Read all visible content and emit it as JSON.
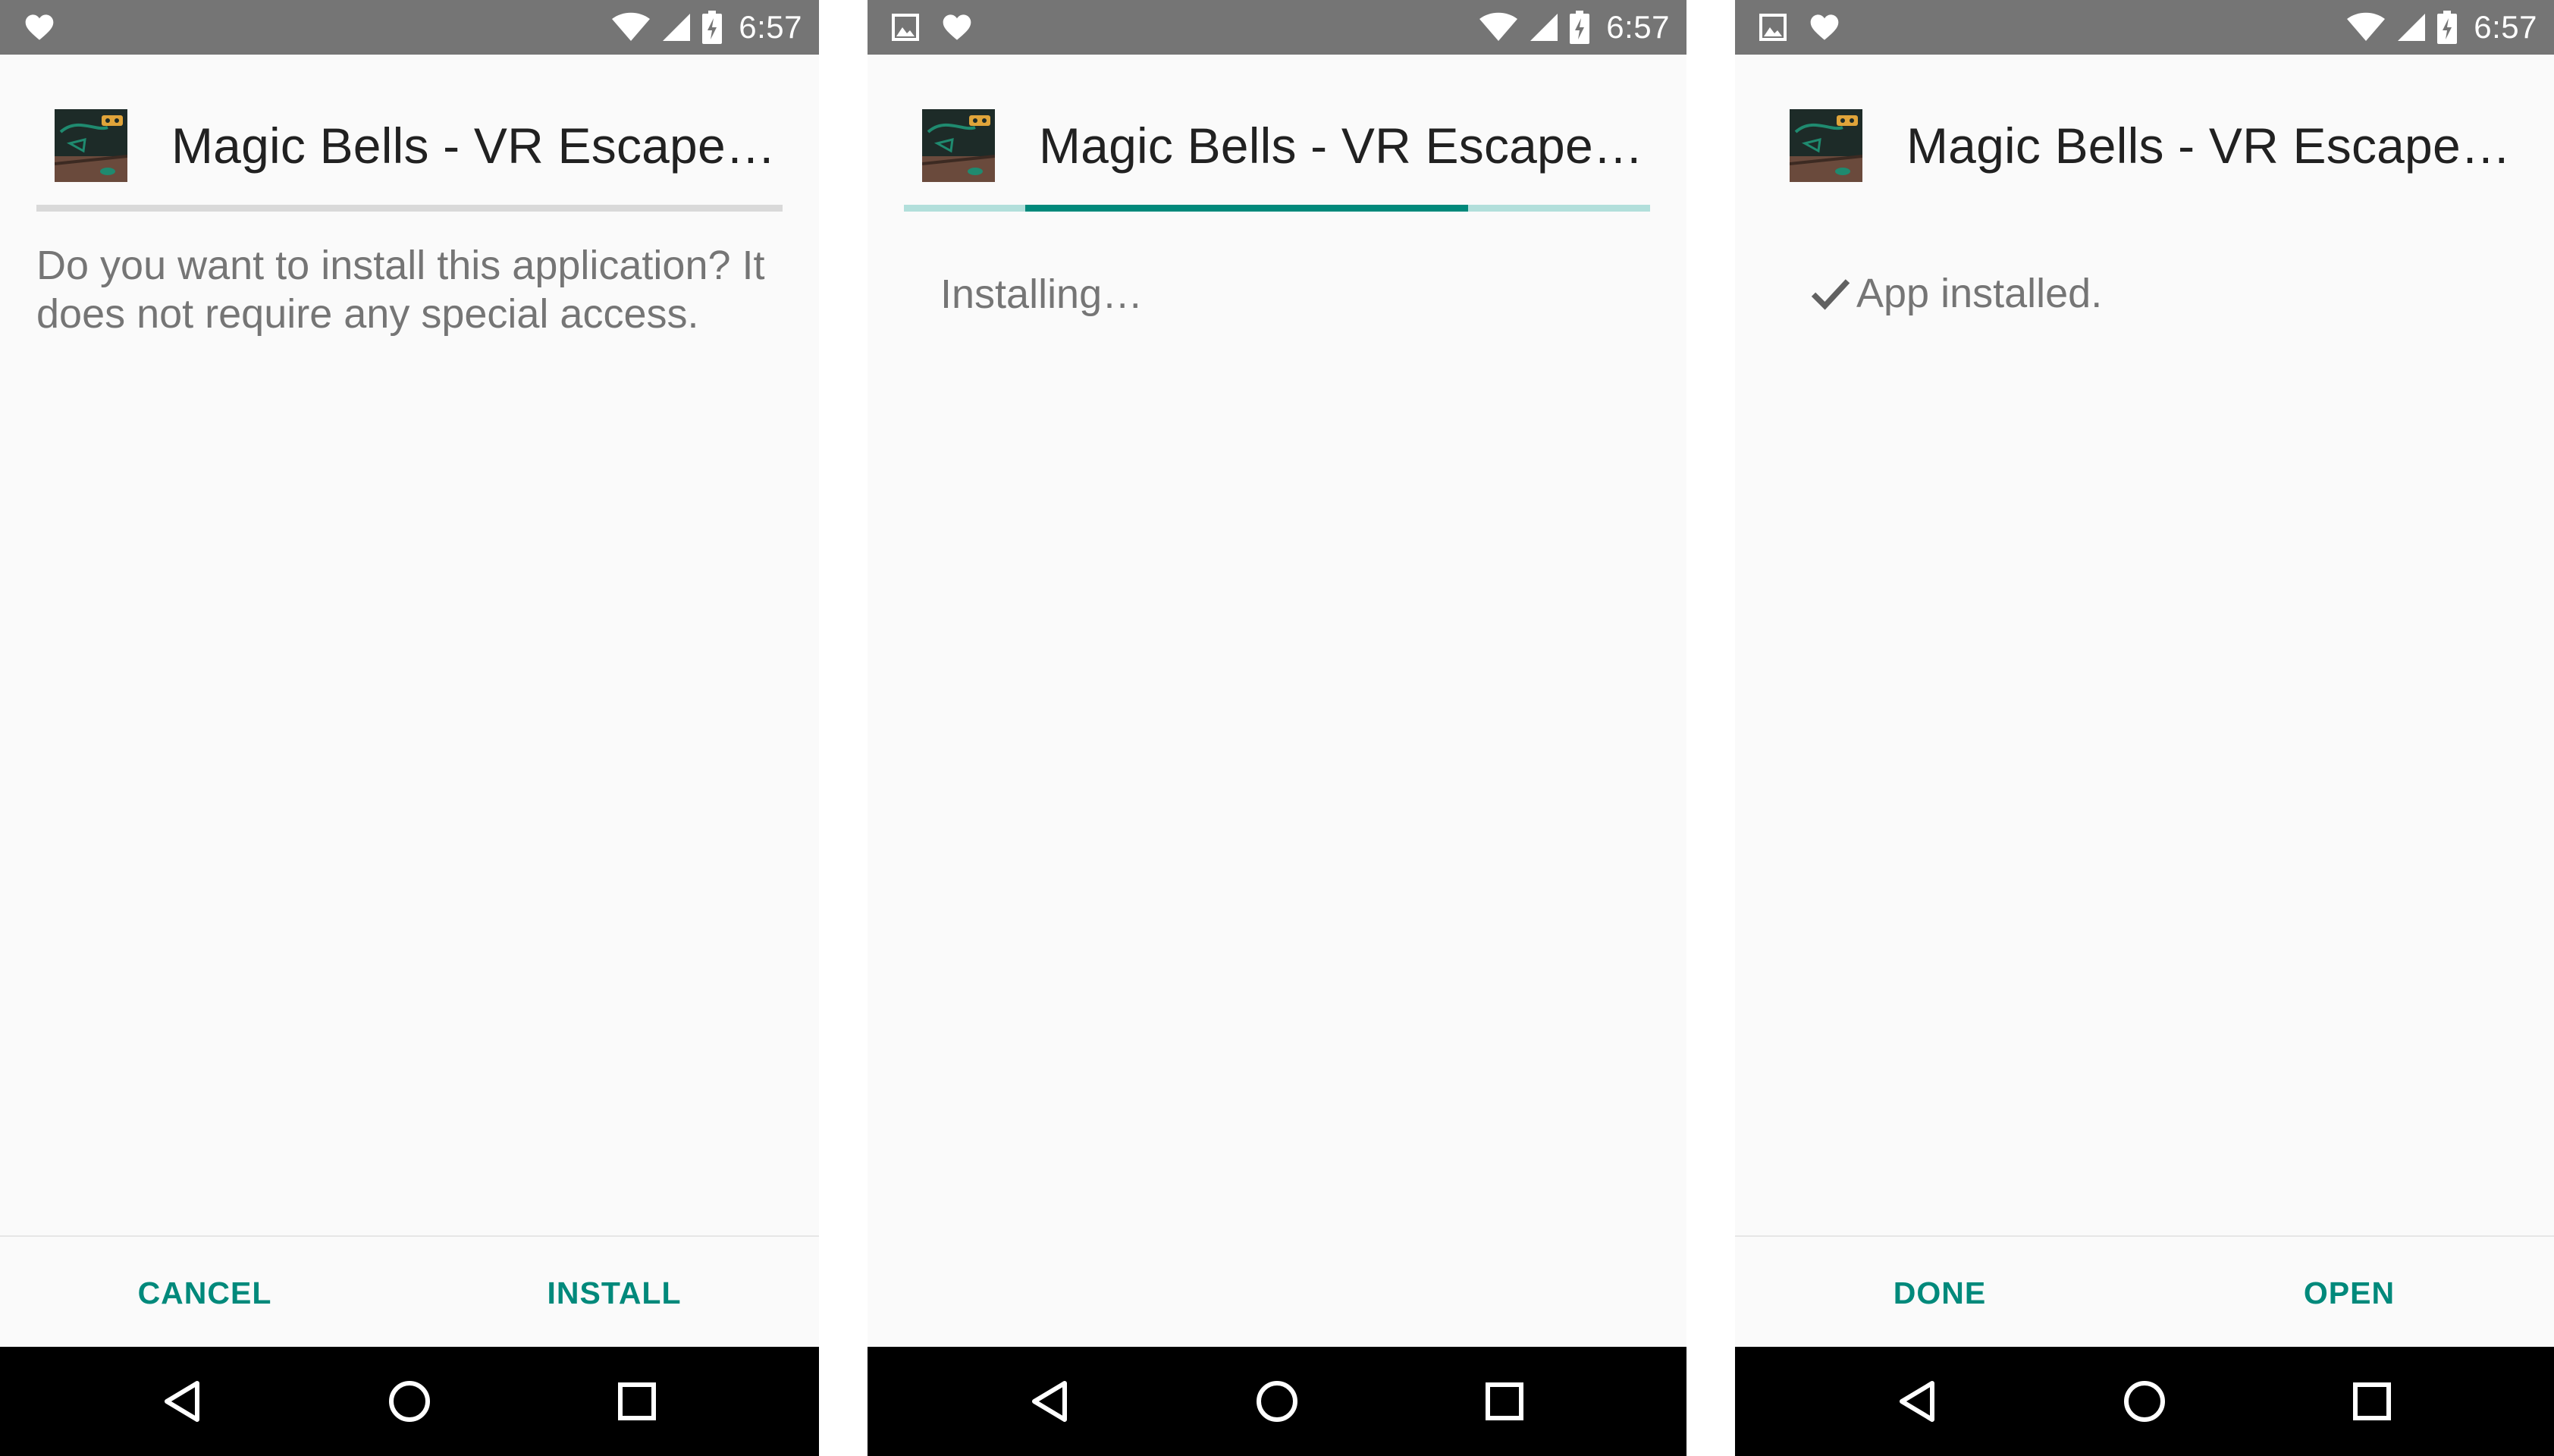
{
  "status_bar": {
    "time": "6:57"
  },
  "app": {
    "title": "Magic Bells - VR Escape…"
  },
  "colors": {
    "accent": "#00897b",
    "status_bar": "#757575",
    "progress_track": "#b2dfdb",
    "nav_bar": "#000000"
  },
  "screens": [
    {
      "message": "Do you want to install this application? It does not require any special access.",
      "actions": {
        "left": "CANCEL",
        "right": "INSTALL"
      }
    },
    {
      "message": "Installing…",
      "progress": {
        "state": "indeterminate"
      }
    },
    {
      "message": "App installed.",
      "actions": {
        "left": "DONE",
        "right": "OPEN"
      }
    }
  ],
  "nav_icons": [
    "back-icon",
    "home-icon",
    "recents-icon"
  ]
}
